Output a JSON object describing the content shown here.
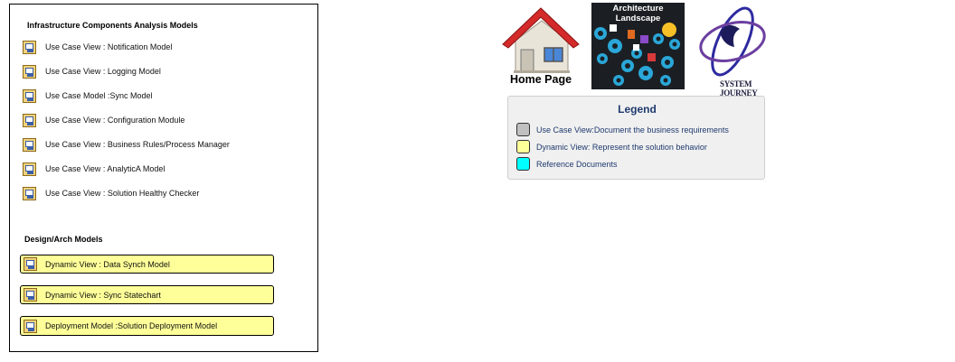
{
  "panel": {
    "infrastructure_title": "Infrastructure Components Analysis Models",
    "infrastructure_items": [
      {
        "label": "Use Case View : Notification Model"
      },
      {
        "label": "Use Case View : Logging Model"
      },
      {
        "label": "Use Case Model :Sync Model"
      },
      {
        "label": "Use Case View : Configuration Module"
      },
      {
        "label": "Use Case View : Business Rules/Process Manager"
      },
      {
        "label": "Use Case View : AnalyticA Model"
      },
      {
        "label": "Use Case View : Solution Healthy Checker"
      }
    ],
    "design_title": "Design/Arch Models",
    "design_items": [
      {
        "label": "Dynamic View : Data Synch Model"
      },
      {
        "label": "Dynamic View : Sync Statechart"
      },
      {
        "label": "Deployment Model :Solution Deployment Model"
      }
    ]
  },
  "nav": {
    "home_label": "Home Page",
    "architecture_label": "Architecture Landscape",
    "system_journey_label": "SYSTEM JOURNEY"
  },
  "legend": {
    "title": "Legend",
    "items": [
      {
        "label": "Use Case View:Document the business requirements",
        "color": "#c0c0c0"
      },
      {
        "label": "Dynamic View: Represent the solution behavior",
        "color": "#ffff99"
      },
      {
        "label": "Reference Documents",
        "color": "#00ffff"
      }
    ]
  },
  "colors": {
    "dynamic_fill": "#ffff99",
    "legend_text": "#1f3a6e",
    "roof": "#d42a2a"
  }
}
